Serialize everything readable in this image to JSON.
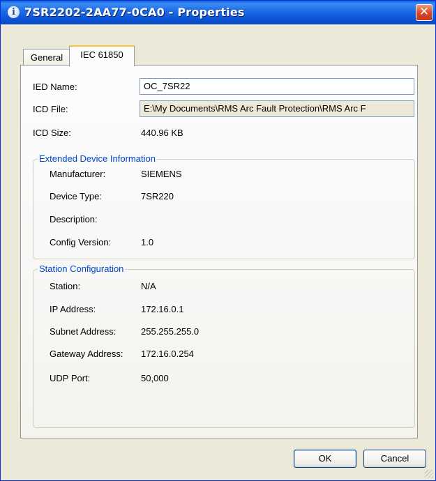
{
  "window": {
    "title": "7SR2202-2AA77-0CA0 - Properties",
    "close_glyph": "✕",
    "info_glyph": "i"
  },
  "tabs": [
    {
      "label": "General"
    },
    {
      "label": "IEC 61850"
    }
  ],
  "fields": {
    "ied_name": {
      "label": "IED Name:",
      "value": "OC_7SR22"
    },
    "icd_file": {
      "label": "ICD File:",
      "value": "E:\\My Documents\\RMS Arc Fault Protection\\RMS Arc F"
    },
    "icd_size": {
      "label": "ICD Size:",
      "value": "440.96 KB"
    }
  },
  "extended": {
    "title": "Extended Device Information",
    "rows": [
      {
        "label": "Manufacturer:",
        "value": "SIEMENS"
      },
      {
        "label": "Device Type:",
        "value": "7SR220"
      },
      {
        "label": "Description:",
        "value": ""
      },
      {
        "label": "Config Version:",
        "value": "1.0"
      }
    ]
  },
  "station": {
    "title": "Station Configuration",
    "rows": [
      {
        "label": "Station:",
        "value": "N/A"
      },
      {
        "label": "IP Address:",
        "value": "172.16.0.1"
      },
      {
        "label": "Subnet Address:",
        "value": "255.255.255.0"
      },
      {
        "label": "Gateway Address:",
        "value": "172.16.0.254"
      },
      {
        "label": "UDP Port:",
        "value": "50,000"
      }
    ]
  },
  "buttons": {
    "ok": "OK",
    "cancel": "Cancel"
  }
}
